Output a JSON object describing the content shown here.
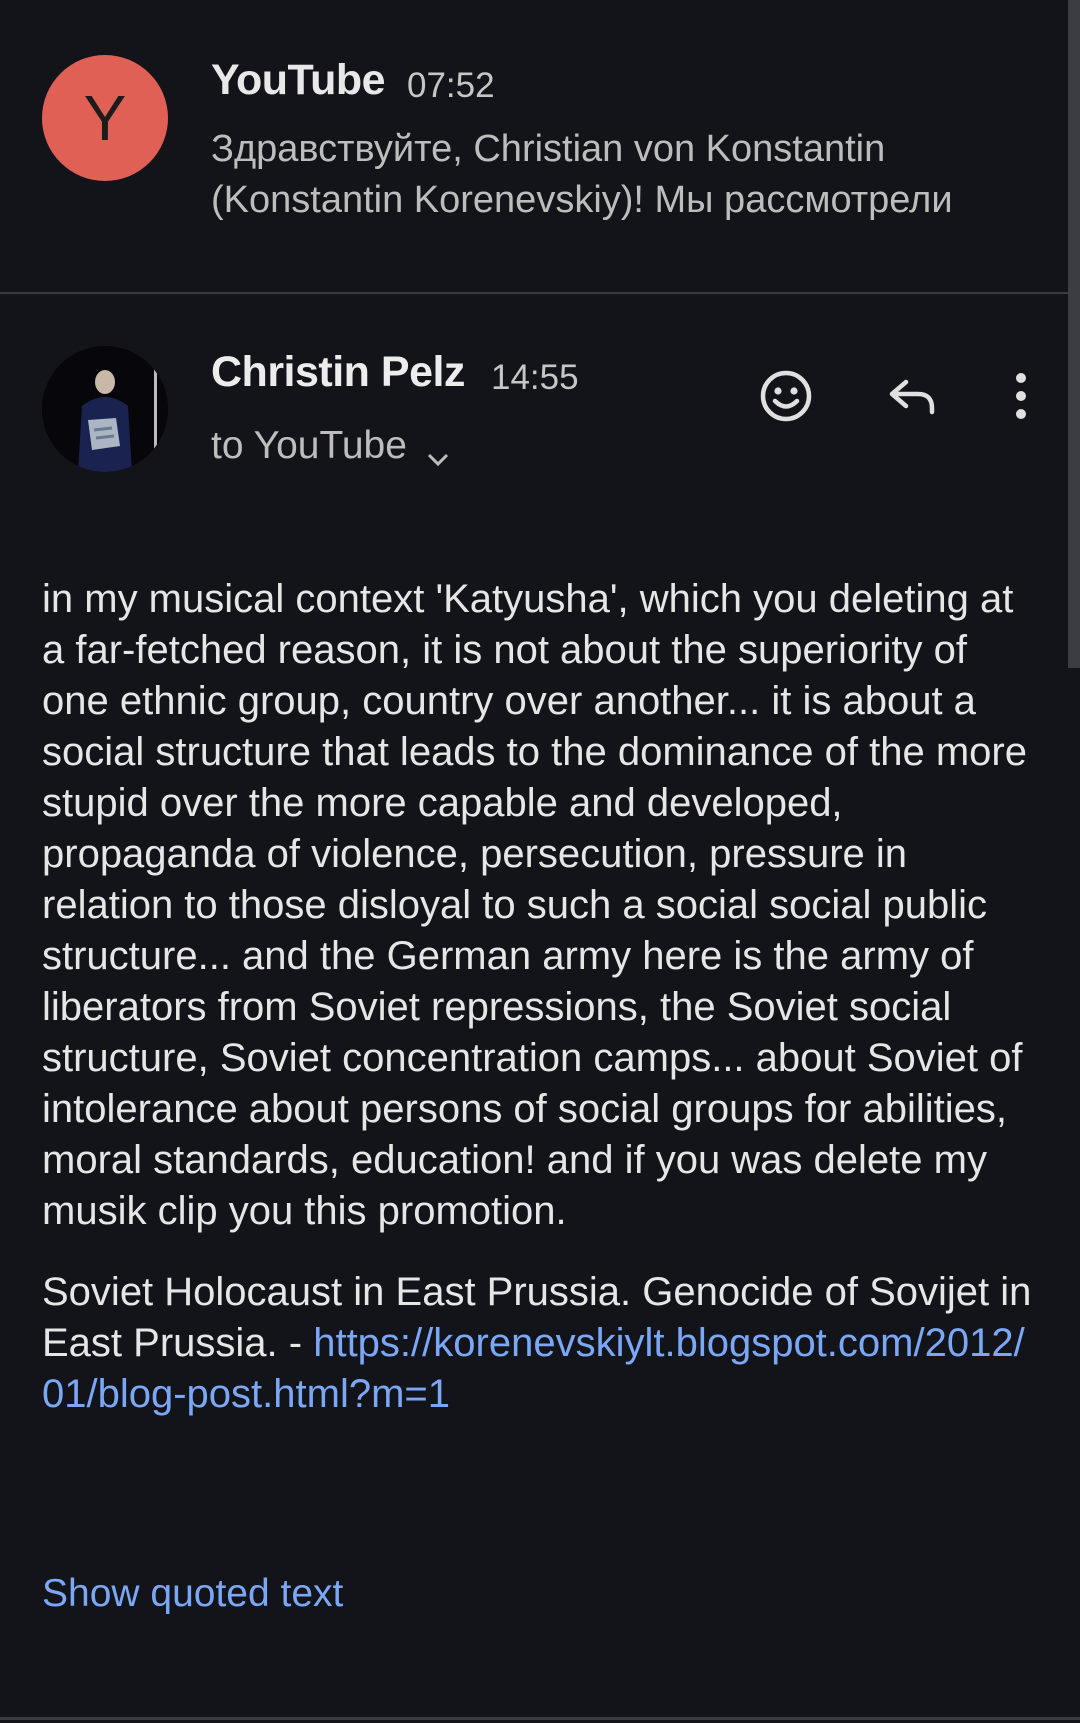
{
  "collapsed_message": {
    "avatar_letter": "Y",
    "avatar_color": "#e06055",
    "sender": "YouTube",
    "time": "07:52",
    "snippet": "Здравствуйте, Christian von Konstantin (Konstantin Korenevskiy)! Мы рассмотрели"
  },
  "expanded_message": {
    "sender": "Christin Pelz",
    "time": "14:55",
    "recipient": "to YouTube",
    "body_paragraph_1": "in my musical context 'Katyusha', which you deleting at a far-fetched reason, it is not about the superiority of one ethnic group, country over another... it is about a social structure that leads to the dominance of the more stupid over the more capable and developed, propaganda of violence, persecution, pressure in relation to those disloyal to such a social social public structure... and the German army here is the army of liberators from Soviet repressions, the Soviet social structure, Soviet concentration camps... about Soviet of intolerance about persons of social groups for abilities, moral standards, education! and if you was delete my musik clip you this promotion.",
    "body_paragraph_2_text": "Soviet Holocaust in East Prussia. Genocide of Sovijet in East Prussia. - ",
    "body_link": "https://korenevskiylt.blogspot.com/2012/01/blog-post.html?m=1",
    "show_quoted_label": "Show quoted text"
  },
  "icons": {
    "emoji": "smiley-face-icon",
    "reply": "reply-arrow-icon",
    "more": "vertical-dots-icon",
    "expand": "chevron-down-icon"
  },
  "colors": {
    "background": "#131419",
    "link": "#7ba7f7"
  }
}
